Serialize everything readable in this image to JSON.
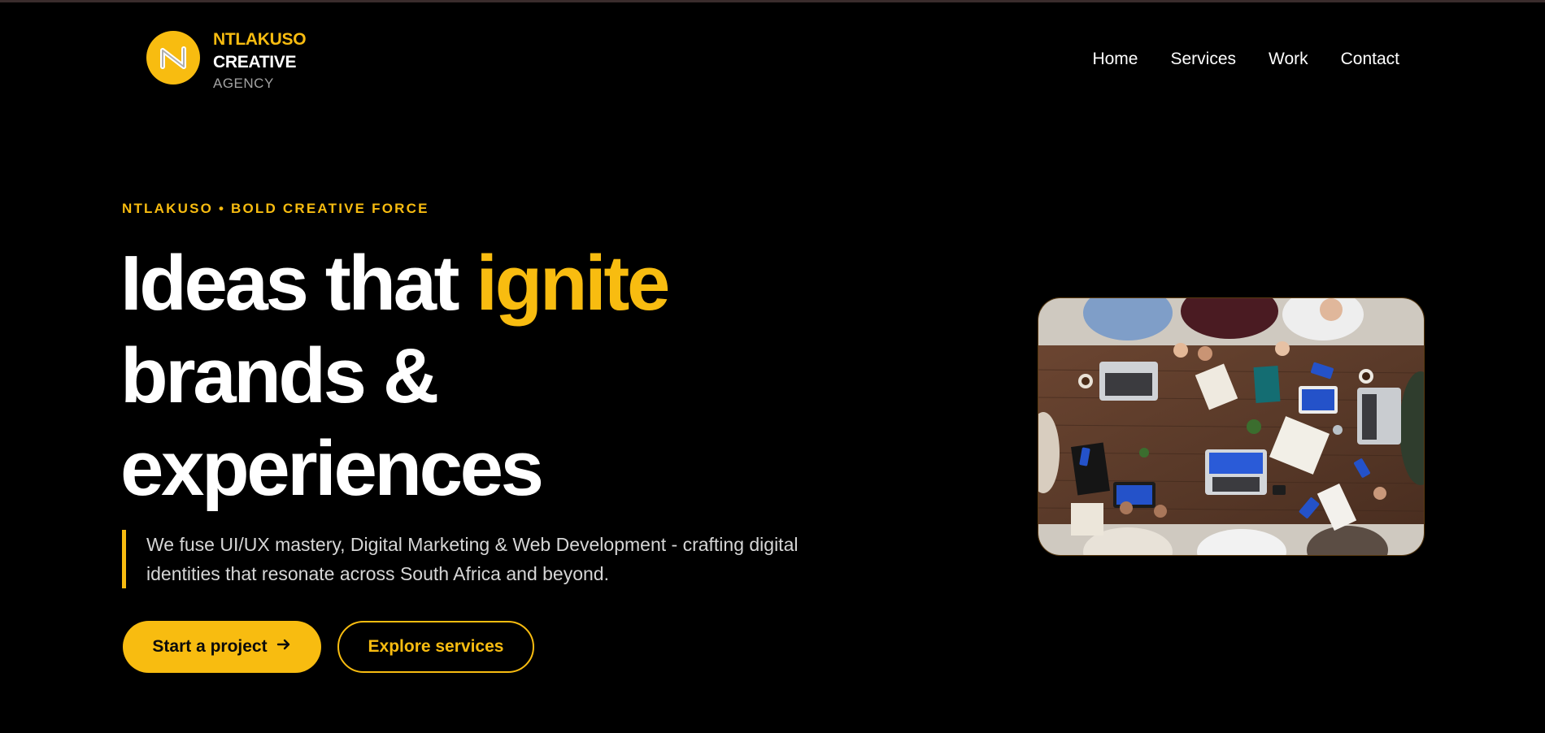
{
  "brand": {
    "line1": "NTLAKUSO",
    "line2": "CREATIVE",
    "line3": "AGENCY",
    "logo_icon": "n-monogram-icon",
    "accent_color": "#f8bc10"
  },
  "nav": {
    "items": [
      {
        "label": "Home"
      },
      {
        "label": "Services"
      },
      {
        "label": "Work"
      },
      {
        "label": "Contact"
      }
    ]
  },
  "hero": {
    "kicker": "NTLAKUSO • BOLD CREATIVE FORCE",
    "headline_part1": "Ideas that ",
    "headline_accent": "ignite",
    "headline_line2": "brands &",
    "headline_line3": "experiences",
    "subtext": "We fuse UI/UX mastery, Digital Marketing & Web Development - crafting digital identities that resonate across South Africa and beyond.",
    "primary_button": "Start a project",
    "primary_button_icon": "arrow-right-icon",
    "secondary_button": "Explore services",
    "image_alt": "team-meeting-photo"
  }
}
